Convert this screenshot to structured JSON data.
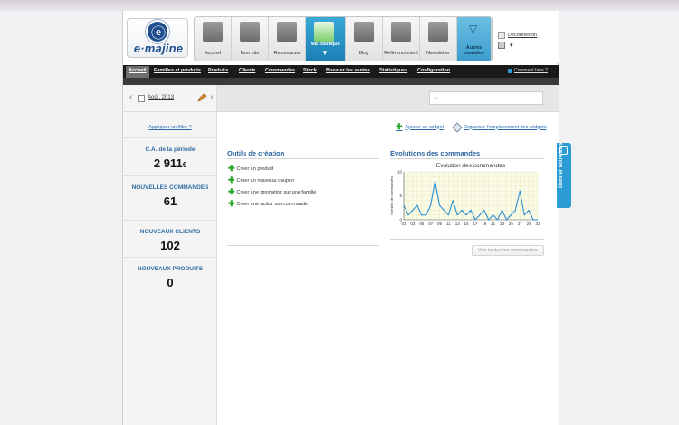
{
  "header": {
    "logo_text": "e·majine",
    "nav": [
      {
        "label": "Accueil",
        "icon": "house-icon",
        "active": false
      },
      {
        "label": "Mon site",
        "icon": "website-icon",
        "active": false
      },
      {
        "label": "Ressources",
        "icon": "resources-icon",
        "active": false
      },
      {
        "label": "Ma boutique",
        "icon": "shopping-cart-icon",
        "active": true
      },
      {
        "label": "Blog",
        "icon": "blog-icon",
        "active": false
      },
      {
        "label": "Référencement",
        "icon": "seo-icon",
        "active": false
      },
      {
        "label": "Newsletter",
        "icon": "newsletter-icon",
        "active": false
      },
      {
        "label": "Autres modules",
        "icon": "chevron-down-icon",
        "active": false
      }
    ],
    "logout_label": "Déconnexion"
  },
  "menubar": {
    "items": [
      "Accueil",
      "Familles et produits",
      "Produits",
      "Clients",
      "Commandes",
      "Stock",
      "Booster les ventes",
      "Statistiques",
      "Configuration"
    ],
    "active_index": 0,
    "help_label": "Comment faire ?"
  },
  "sidebar": {
    "date_label": "Août. 2013",
    "filter_link": "Appliquer un filtre ?",
    "stats": [
      {
        "label": "C.A. de la période",
        "value": "2 911",
        "unit": "€"
      },
      {
        "label": "NOUVELLES COMMANDES",
        "value": "61",
        "unit": ""
      },
      {
        "label": "NOUVEAUX CLIENTS",
        "value": "102",
        "unit": ""
      },
      {
        "label": "NOUVEAUX PRODUITS",
        "value": "0",
        "unit": ""
      }
    ]
  },
  "main": {
    "add_widget": "Ajouter un widget",
    "organize_widgets": "Organiser l'emplacement des widgets",
    "tools": {
      "title": "Outils de création",
      "items": [
        "Créer un produit",
        "Créer un nouveau coupon",
        "Créer une promotion sur une famille",
        "Créer une action sur commande"
      ]
    },
    "orders": {
      "title": "Evolutions des commandes",
      "button": "Voir toutes les commandes"
    }
  },
  "feedback_label": "Donner votre avis",
  "chart_data": {
    "type": "line",
    "title": "Evolution des commandes",
    "ylabel": "Nombre de commandes",
    "xlabel": "",
    "x": [
      "01",
      "02",
      "03",
      "04",
      "05",
      "06",
      "07",
      "08",
      "09",
      "10",
      "11",
      "12",
      "13",
      "14",
      "15",
      "16",
      "17",
      "18",
      "19",
      "20",
      "21",
      "22",
      "23",
      "24",
      "25",
      "26",
      "27",
      "28",
      "29",
      "30",
      "31"
    ],
    "x_tick_labels": [
      "01",
      "03",
      "05",
      "07",
      "09",
      "11",
      "13",
      "15",
      "17",
      "19",
      "21",
      "23",
      "25",
      "27",
      "29",
      "31"
    ],
    "values": [
      3,
      1,
      2,
      3,
      1,
      1,
      3,
      8,
      3,
      2,
      1,
      4,
      1,
      2,
      1,
      2,
      0,
      1,
      2,
      0,
      1,
      0,
      2,
      0,
      1,
      2,
      6,
      1,
      2,
      0,
      0
    ],
    "ylim": [
      0,
      10
    ],
    "yticks": [
      0,
      5,
      10
    ],
    "color": "#2a8fd0",
    "grid": true
  }
}
